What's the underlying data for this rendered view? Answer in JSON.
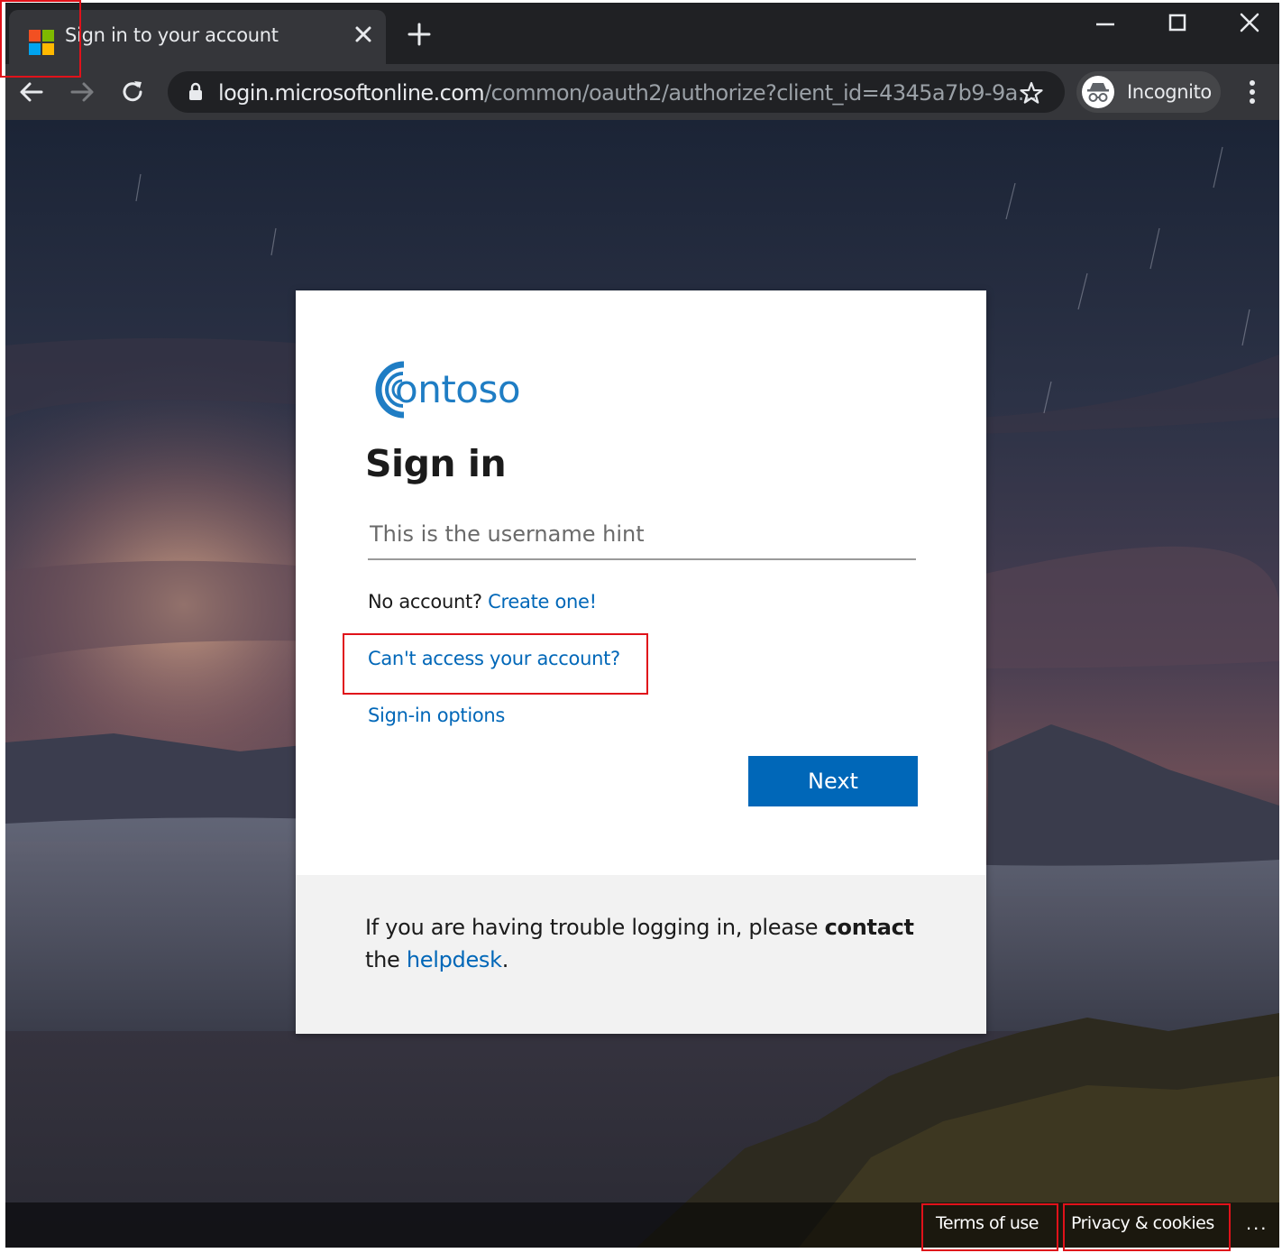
{
  "browser": {
    "tab": {
      "title": "Sign in to your account",
      "favicon": "microsoft-logo-icon"
    },
    "address": {
      "host": "login.microsoftonline.com",
      "path": "/common/oauth2/authorize?client_id=4345a7b9-9a..."
    },
    "profile": {
      "label": "Incognito",
      "icon": "incognito-icon"
    }
  },
  "signin": {
    "logo_text": "ontoso",
    "heading": "Sign in",
    "username_placeholder": "This is the username hint",
    "no_account_text": "No account?",
    "create_link": "Create one!",
    "cant_access_link": "Can't access your account?",
    "signin_options_link": "Sign-in options",
    "next_label": "Next",
    "help": {
      "before": "If you are having trouble logging in, please",
      "bold": "contact",
      "middle": "the",
      "link": "helpdesk",
      "after": "."
    }
  },
  "footer": {
    "terms": "Terms of use",
    "privacy": "Privacy & cookies",
    "more": "..."
  },
  "colors": {
    "accent": "#0067b8",
    "browser_dark": "#202124",
    "browser_toolbar": "#35363a",
    "highlight": "#e0121a",
    "logo_blue": "#1f7dc4"
  }
}
